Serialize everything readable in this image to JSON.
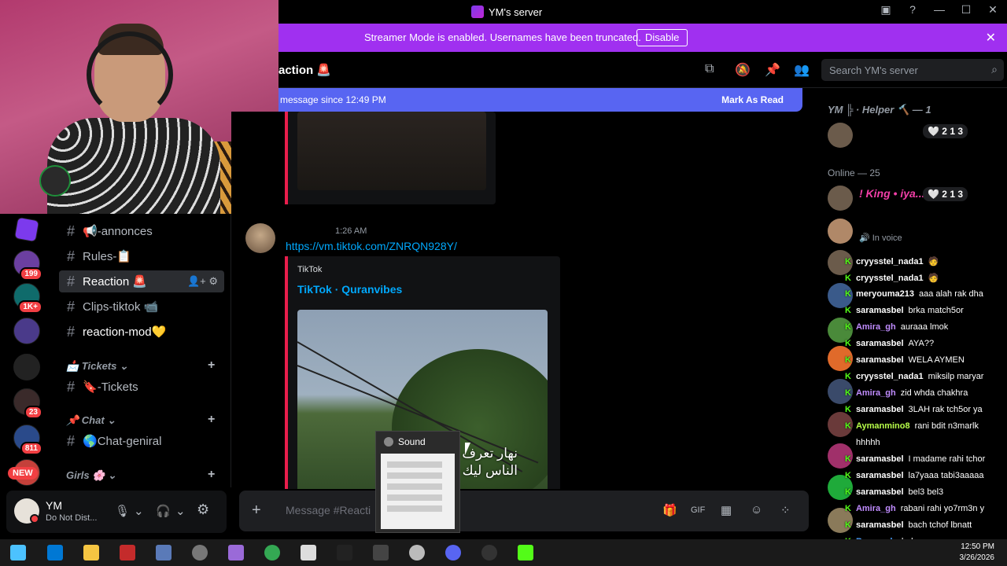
{
  "window": {
    "title": "YM's server"
  },
  "streamer_bar": {
    "message": "Streamer Mode is enabled. Usernames have been truncated.",
    "disable_label": "Disable"
  },
  "guild_badges": [
    "199",
    "1K+",
    "23",
    "811"
  ],
  "guild_new_label": "NEW",
  "channels": [
    {
      "name": "📢-annonces"
    },
    {
      "name": "Rules-📋"
    },
    {
      "name": "Reaction 🚨"
    },
    {
      "name": "Clips-tiktok 📹"
    },
    {
      "name": "reaction-mod💛"
    }
  ],
  "categories": {
    "tickets": "📩 Tickets",
    "tickets_channel": "🔖-Tickets",
    "chat": "📌 Chat",
    "chat_channel": "🌎Chat-geniral",
    "girls": "Girls 🌸"
  },
  "user": {
    "name": "YM",
    "status": "Do Not Dist..."
  },
  "header": {
    "channel_name": "action 🚨",
    "search_placeholder": "Search YM's server"
  },
  "new_messages": {
    "text": "message since 12:49 PM",
    "mark_read": "Mark As Read"
  },
  "message": {
    "time": "1:26 AM",
    "link": "https://vm.tiktok.com/ZNRQN928Y/",
    "embed_provider": "TikTok",
    "embed_title": "TikTok · Quranvibes",
    "overlay_line1": "نهار تعرف ربي الي اقرب",
    "overlay_line2": "الناس ليك تتبدل حياتك"
  },
  "composer": {
    "placeholder": "Message #Reacti"
  },
  "sound_popup": {
    "title": "Sound"
  },
  "members": {
    "role_header": "YM ╠ · Helper 🔨 — 1",
    "helper_badge": "🤍 2 1 3",
    "online_header": "Online — 25",
    "king_name": "! King • iya...",
    "king_badge": "🤍 2 1 3",
    "in_voice": "🔊 In voice"
  },
  "chat_overlay": [
    {
      "user": "cryysstel_nada1",
      "text": "🧑"
    },
    {
      "user": "cryysstel_nada1",
      "text": "🧑"
    },
    {
      "user": "meryouma213",
      "text": "aaa alah rak dha"
    },
    {
      "user": "saramasbel",
      "text": "brka match5or"
    },
    {
      "user": "Amira_gh",
      "text": "auraaa lmok"
    },
    {
      "user": "saramasbel",
      "text": "AYA??"
    },
    {
      "user": "saramasbel",
      "text": "WELA AYMEN"
    },
    {
      "user": "cryysstel_nada1",
      "text": "miksilp maryar"
    },
    {
      "user": "Amira_gh",
      "text": "zid whda chakhra"
    },
    {
      "user": "saramasbel",
      "text": "3LAH rak tch5or ya"
    },
    {
      "user": "Aymanmino8",
      "text": "rani bdit n3marlk"
    },
    {
      "user": "",
      "text": "hhhhh"
    },
    {
      "user": "saramasbel",
      "text": "I madame rahi tchor"
    },
    {
      "user": "saramasbel",
      "text": "la7yaaa tabi3aaaaa"
    },
    {
      "user": "saramasbel",
      "text": "bel3 bel3"
    },
    {
      "user": "Amira_gh",
      "text": "rabani rahi yo7rm3n y"
    },
    {
      "user": "saramasbel",
      "text": "bach tchof lbnatt"
    },
    {
      "user": "Bouaaed",
      "text": "chekeyen"
    }
  ],
  "tray": {
    "time": "12:50 PM",
    "date": "3/26/2026"
  },
  "colors": {
    "accent": "#5865f2",
    "streamer": "#a030f0",
    "kick_green": "#53fc18",
    "dnd": "#f23f43"
  }
}
